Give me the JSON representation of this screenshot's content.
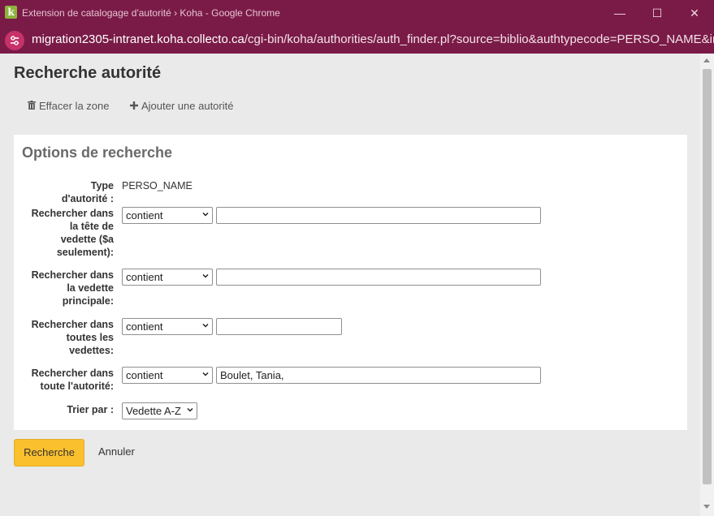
{
  "window": {
    "title": "Extension de catalogage d'autorité › Koha - Google Chrome",
    "app_icon_letter": "k"
  },
  "address_bar": {
    "url_host": "migration2305-intranet.koha.collecto.ca",
    "url_path": "/cgi-bin/koha/authorities/auth_finder.pl?source=biblio&authtypecode=PERSO_NAME&ind..."
  },
  "page": {
    "title": "Recherche autorité",
    "toolbar": {
      "clear_label": "Effacer la zone",
      "add_label": "Ajouter une autorité"
    }
  },
  "search_options": {
    "title": "Options de recherche",
    "authority_type": {
      "label_line1": "Type",
      "label_line2": "d'autorité :",
      "value": "PERSO_NAME"
    },
    "main_entry_a": {
      "label_lines": [
        "Rechercher dans",
        "la tête de",
        "vedette ($a",
        "seulement):"
      ],
      "operator": "contient",
      "value": ""
    },
    "main_entry": {
      "label_lines": [
        "Rechercher dans",
        "la vedette",
        "principale:"
      ],
      "operator": "contient",
      "value": ""
    },
    "all_headings": {
      "label_lines": [
        "Rechercher dans",
        "toutes les",
        "vedettes:"
      ],
      "operator": "contient",
      "value": ""
    },
    "whole_record": {
      "label_lines": [
        "Rechercher dans",
        "toute l'autorité:"
      ],
      "operator": "contient",
      "value": "Boulet, Tania,"
    },
    "sort": {
      "label": "Trier par :",
      "value": "Vedette A-Z"
    }
  },
  "actions": {
    "search_label": "Recherche",
    "cancel_label": "Annuler"
  },
  "colors": {
    "chrome_frame": "#7a1b47",
    "primary_button": "#fbc02d",
    "page_background": "#eaeaea",
    "panel_background": "#ffffff"
  }
}
